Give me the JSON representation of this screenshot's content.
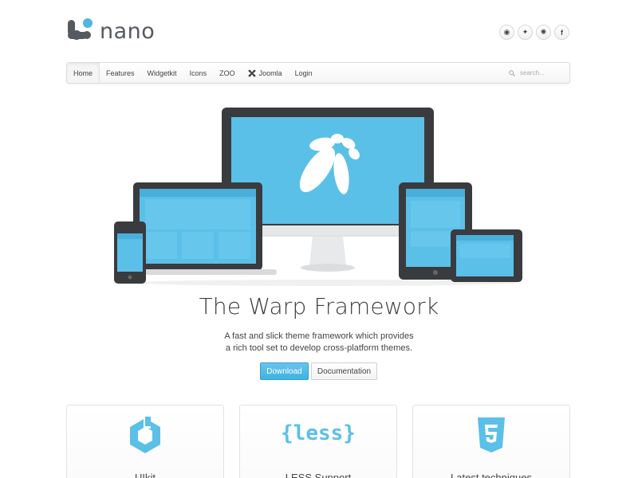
{
  "header": {
    "brand": "nano",
    "social": [
      {
        "icon": "github-icon",
        "glyph": "◉"
      },
      {
        "icon": "twitter-icon",
        "glyph": "✦"
      },
      {
        "icon": "dribbble-icon",
        "glyph": "✺"
      },
      {
        "icon": "facebook-icon",
        "glyph": "f"
      }
    ]
  },
  "nav": {
    "items": [
      {
        "label": "Home",
        "active": true
      },
      {
        "label": "Features"
      },
      {
        "label": "Widgetkit"
      },
      {
        "label": "Icons"
      },
      {
        "label": "ZOO"
      },
      {
        "label": "Joomla",
        "icon": "joomla-icon"
      },
      {
        "label": "Login"
      }
    ],
    "search_placeholder": "search..."
  },
  "hero": {
    "title": "The Warp Framework",
    "subtitle_line1": "A fast and slick theme framework which provides",
    "subtitle_line2": "a rich tool set to develop cross-platform themes.",
    "download_label": "Download",
    "documentation_label": "Documentation"
  },
  "features": [
    {
      "title": "UIkit",
      "icon": "uikit-icon"
    },
    {
      "title": "LESS Support",
      "icon": "less-icon",
      "icon_text": "{less}"
    },
    {
      "title": "Latest techniques",
      "icon": "html5-icon"
    }
  ],
  "colors": {
    "accent": "#5bc0e8",
    "screen": "#5bc0e8",
    "device_frame": "#3a3b3f",
    "logo_dark": "#555a60",
    "logo_blue": "#4fb6e1"
  }
}
